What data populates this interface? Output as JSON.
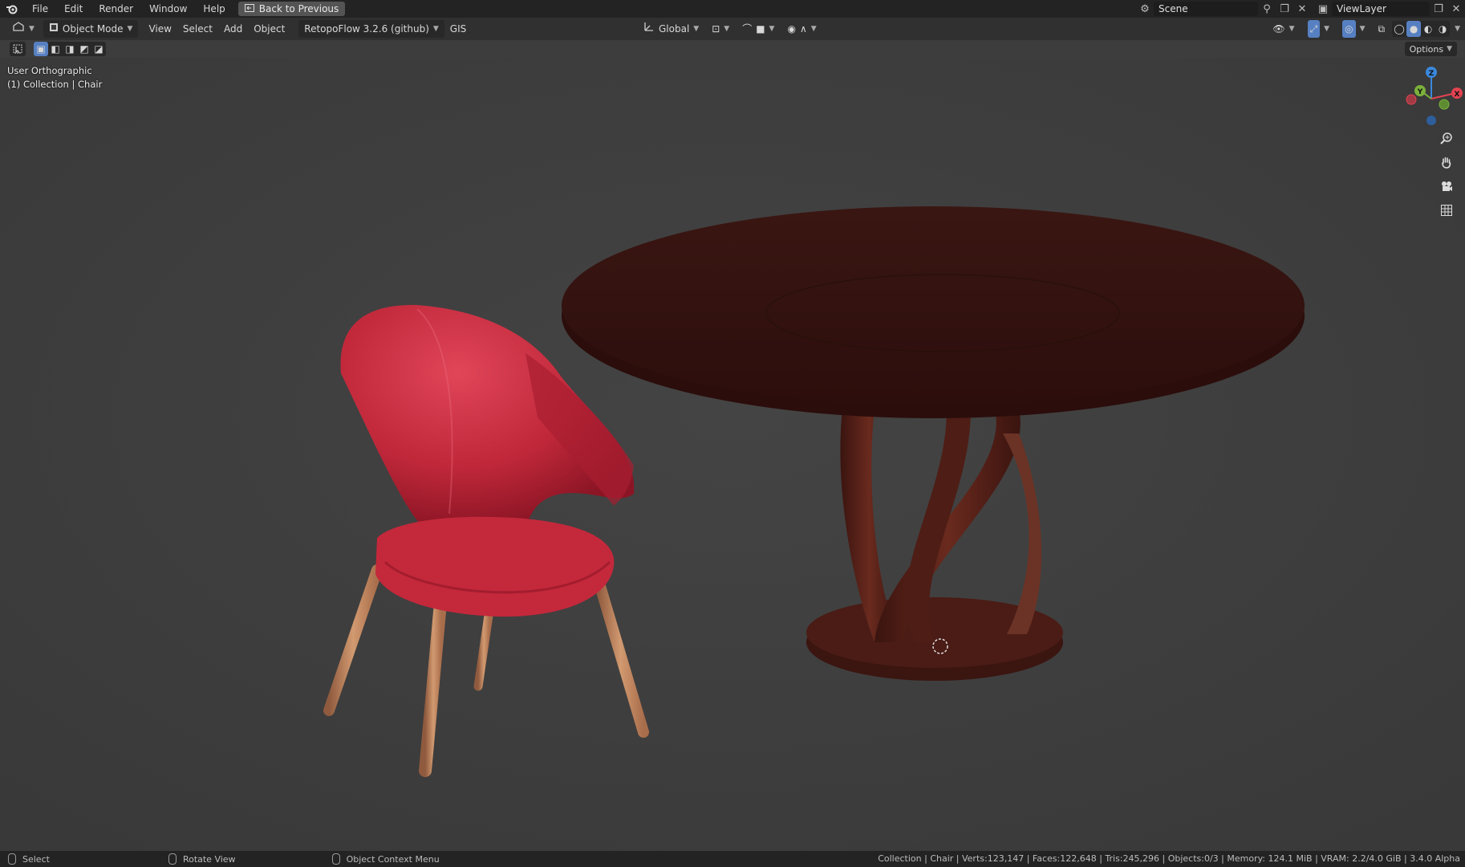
{
  "topbar": {
    "menus": [
      "File",
      "Edit",
      "Render",
      "Window",
      "Help"
    ],
    "back_button": "Back to Previous",
    "scene_name": "Scene",
    "view_layer": "ViewLayer"
  },
  "header": {
    "mode": "Object Mode",
    "menus": [
      "View",
      "Select",
      "Add",
      "Object"
    ],
    "addon": "RetopoFlow 3.2.6 (github)",
    "gis": "GIS",
    "transform_orientation": "Global"
  },
  "toolrow": {
    "options_label": "Options"
  },
  "viewport": {
    "view_name": "User Orthographic",
    "collection_info": "(1) Collection | Chair"
  },
  "gizmo": {
    "x_label": "X",
    "y_label": "Y",
    "z_label": "Z",
    "colors": {
      "x": "#e24350",
      "y": "#7bb13b",
      "z": "#3a88dd"
    }
  },
  "statusbar": {
    "select": "Select",
    "rotate": "Rotate View",
    "context_menu": "Object Context Menu",
    "stats": "Collection | Chair | Verts:123,147 | Faces:122,648 | Tris:245,296 | Objects:0/3 | Memory: 124.1 MiB | VRAM: 2.2/4.0 GiB | 3.4.0 Alpha"
  },
  "scene_objects": {
    "chair_color": "#c0283a",
    "leg_color": "#c7875c",
    "table_color": "#3e1511"
  }
}
